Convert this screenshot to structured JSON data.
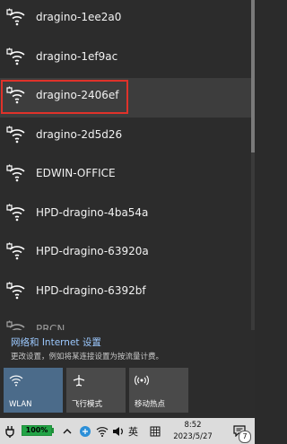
{
  "networks": [
    {
      "name": "dragino-1ee2a0",
      "secured": false
    },
    {
      "name": "dragino-1ef9ac",
      "secured": false
    },
    {
      "name": "dragino-2406ef",
      "secured": false,
      "selected": true
    },
    {
      "name": "dragino-2d5d26",
      "secured": false
    },
    {
      "name": "EDWIN-OFFICE",
      "secured": true
    },
    {
      "name": "HPD-dragino-4ba54a",
      "secured": false
    },
    {
      "name": "HPD-dragino-63920a",
      "secured": false
    },
    {
      "name": "HPD-dragino-6392bf",
      "secured": false
    },
    {
      "name": "PRCN",
      "secured": false,
      "partial": true
    }
  ],
  "settings": {
    "title": "网络和 Internet 设置",
    "description": "更改设置，例如将某连接设置为按流量计费。"
  },
  "quick_actions": [
    {
      "label": "WLAN",
      "icon": "wifi-icon",
      "active": true
    },
    {
      "label": "飞行模式",
      "icon": "airplane-icon",
      "active": false
    },
    {
      "label": "移动热点",
      "icon": "hotspot-icon",
      "active": false
    }
  ],
  "taskbar": {
    "battery_percent": "100%",
    "language": "英",
    "time": "8:52",
    "date": "2023/5/27",
    "notification_count": "7"
  }
}
